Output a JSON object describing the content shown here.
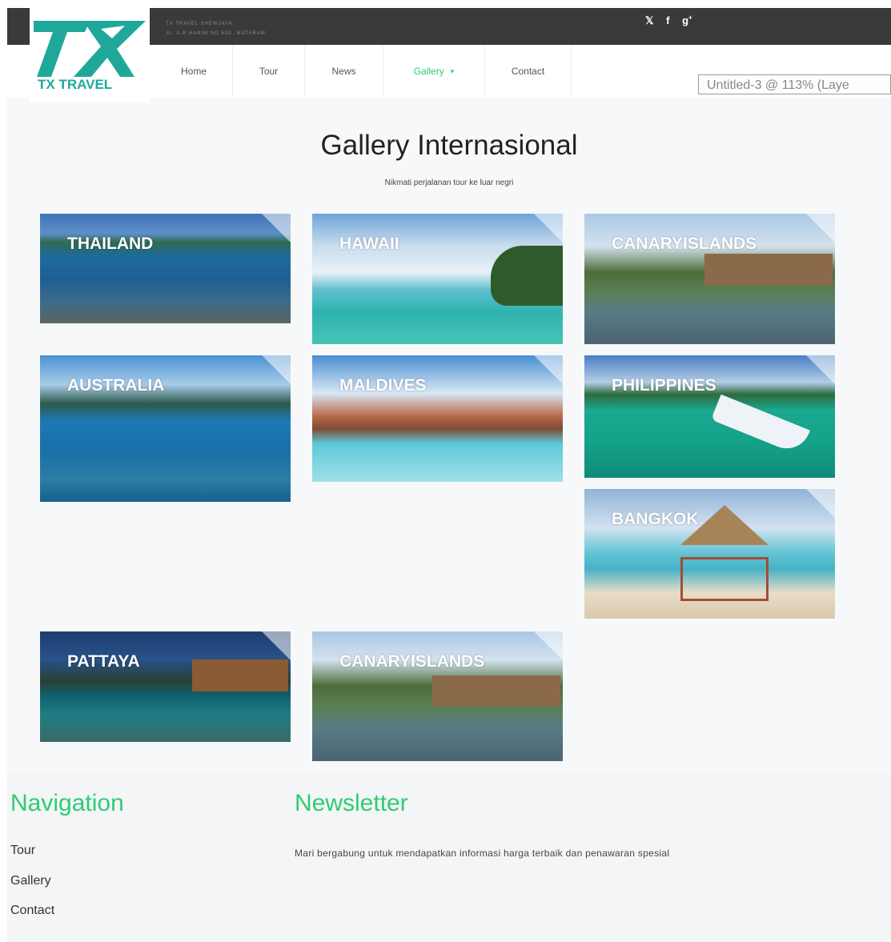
{
  "header": {
    "address_line1": "TX TRAVEL SHEWJAYA",
    "address_line2": "JL. A.R HAKIM NO 53D, MATARAM",
    "logo_text": "TX TRAVEL",
    "social": [
      "twitter-icon",
      "facebook-icon",
      "google-plus-icon"
    ]
  },
  "nav": {
    "items": [
      {
        "label": "Home"
      },
      {
        "label": "Tour"
      },
      {
        "label": "News"
      },
      {
        "label": "Gallery"
      },
      {
        "label": "Contact"
      }
    ],
    "active": "Gallery"
  },
  "overlay_tooltip": "Untitled-3 @ 113% (Laye",
  "gallery": {
    "title": "Gallery Internasional",
    "subtitle": "Nikmati perjalanan tour ke luar negri",
    "items": [
      {
        "label": "THAILAND"
      },
      {
        "label": "HAWAII"
      },
      {
        "label": "CANARYISLANDS"
      },
      {
        "label": "AUSTRALIA"
      },
      {
        "label": "MALDIVES"
      },
      {
        "label": "PHILIPPINES"
      },
      {
        "label": "BANGKOK"
      },
      {
        "label": "PATTAYA"
      },
      {
        "label": "CANARYISLANDS"
      }
    ]
  },
  "footer": {
    "navigation_title": "Navigation",
    "navigation_links": [
      {
        "label": "Tour"
      },
      {
        "label": "Gallery"
      },
      {
        "label": "Contact"
      }
    ],
    "newsletter_title": "Newsletter",
    "newsletter_text": "Mari bergabung untuk mendapatkan informasi harga terbaik dan penawaran spesial"
  },
  "colors": {
    "topbar": "#3a3a3a",
    "accent_green": "#2ecc71",
    "logo_teal": "#1fa89a"
  }
}
